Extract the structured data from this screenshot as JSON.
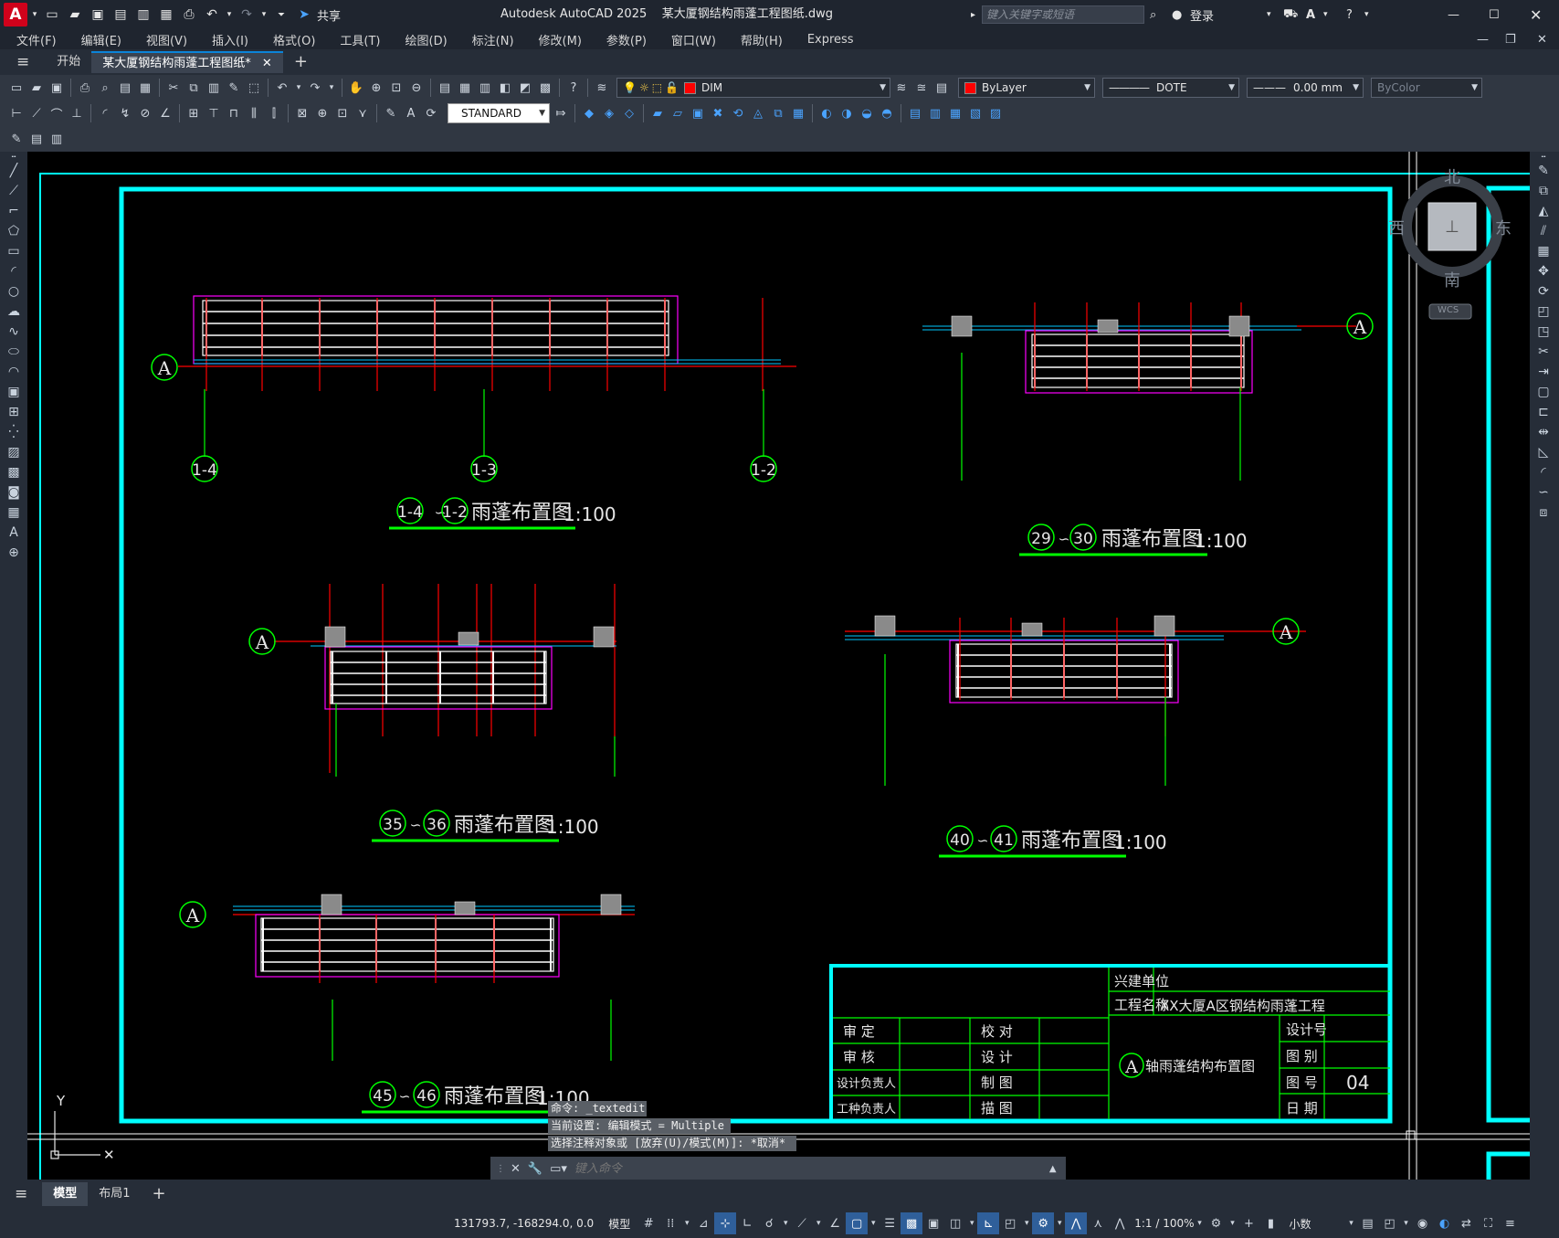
{
  "app": {
    "logo_letter": "A",
    "title": "Autodesk AutoCAD 2025",
    "filename": "某大厦钢结构雨蓬工程图纸.dwg",
    "share_label": "共享",
    "search_placeholder": "键入关键字或短语",
    "login_label": "登录"
  },
  "menu": [
    "文件(F)",
    "编辑(E)",
    "视图(V)",
    "插入(I)",
    "格式(O)",
    "工具(T)",
    "绘图(D)",
    "标注(N)",
    "修改(M)",
    "参数(P)",
    "窗口(W)",
    "帮助(H)",
    "Express"
  ],
  "tabs": {
    "start": "开始",
    "document": "某大厦钢结构雨蓬工程图纸*"
  },
  "toolbar": {
    "layer": "DIM",
    "color": "ByLayer",
    "linetype": "DOTE",
    "lineweight": "0.00 mm",
    "plotstyle": "ByColor",
    "text_style": "STANDARD",
    "layer_color": "#ff0000"
  },
  "viewcube": {
    "north": "北",
    "south": "南",
    "east": "东",
    "west": "西",
    "wcs": "WCS"
  },
  "drawing": {
    "axis_A": "A",
    "ucs_y": "Y",
    "views": [
      {
        "from": "1-4",
        "to": "1-2",
        "name": "雨蓬布置图",
        "scale": "1:100",
        "markers": [
          "1-4",
          "1-3",
          "1-2"
        ]
      },
      {
        "from": "29",
        "to": "30",
        "name": "雨蓬布置图",
        "scale": "1:100"
      },
      {
        "from": "35",
        "to": "36",
        "name": "雨蓬布置图",
        "scale": "1:100"
      },
      {
        "from": "40",
        "to": "41",
        "name": "雨蓬布置图",
        "scale": "1:100"
      },
      {
        "from": "45",
        "to": "46",
        "name": "雨蓬布置图",
        "scale": "1:100"
      }
    ],
    "title_block": {
      "owner_label": "兴建单位",
      "owner_value": "",
      "project_label": "工程名称",
      "project_value": "XX大厦A区钢结构雨蓬工程",
      "approve": "审 定",
      "check": "校 对",
      "review": "审 核",
      "design": "设 计",
      "design_lead": "设计负责人",
      "draw": "制 图",
      "eng_lead": "工种负责人",
      "trace": "描 图",
      "drawing_title_axis": "A",
      "drawing_title": "轴雨蓬结构布置图",
      "design_no": "设计号",
      "category": "图 别",
      "sheet_no_label": "图 号",
      "sheet_no": "04",
      "date": "日 期"
    }
  },
  "command": {
    "history": [
      "命令: _textedit",
      "当前设置: 编辑模式 = Multiple",
      "选择注释对象或 [放弃(U)/模式(M)]: *取消*"
    ],
    "placeholder": "键入命令"
  },
  "layouts": {
    "model": "模型",
    "layout1": "布局1"
  },
  "status": {
    "coords": "131793.7, -168294.0, 0.0",
    "space": "模型",
    "annoscale": "1:1 / 100%",
    "units": "小数"
  }
}
